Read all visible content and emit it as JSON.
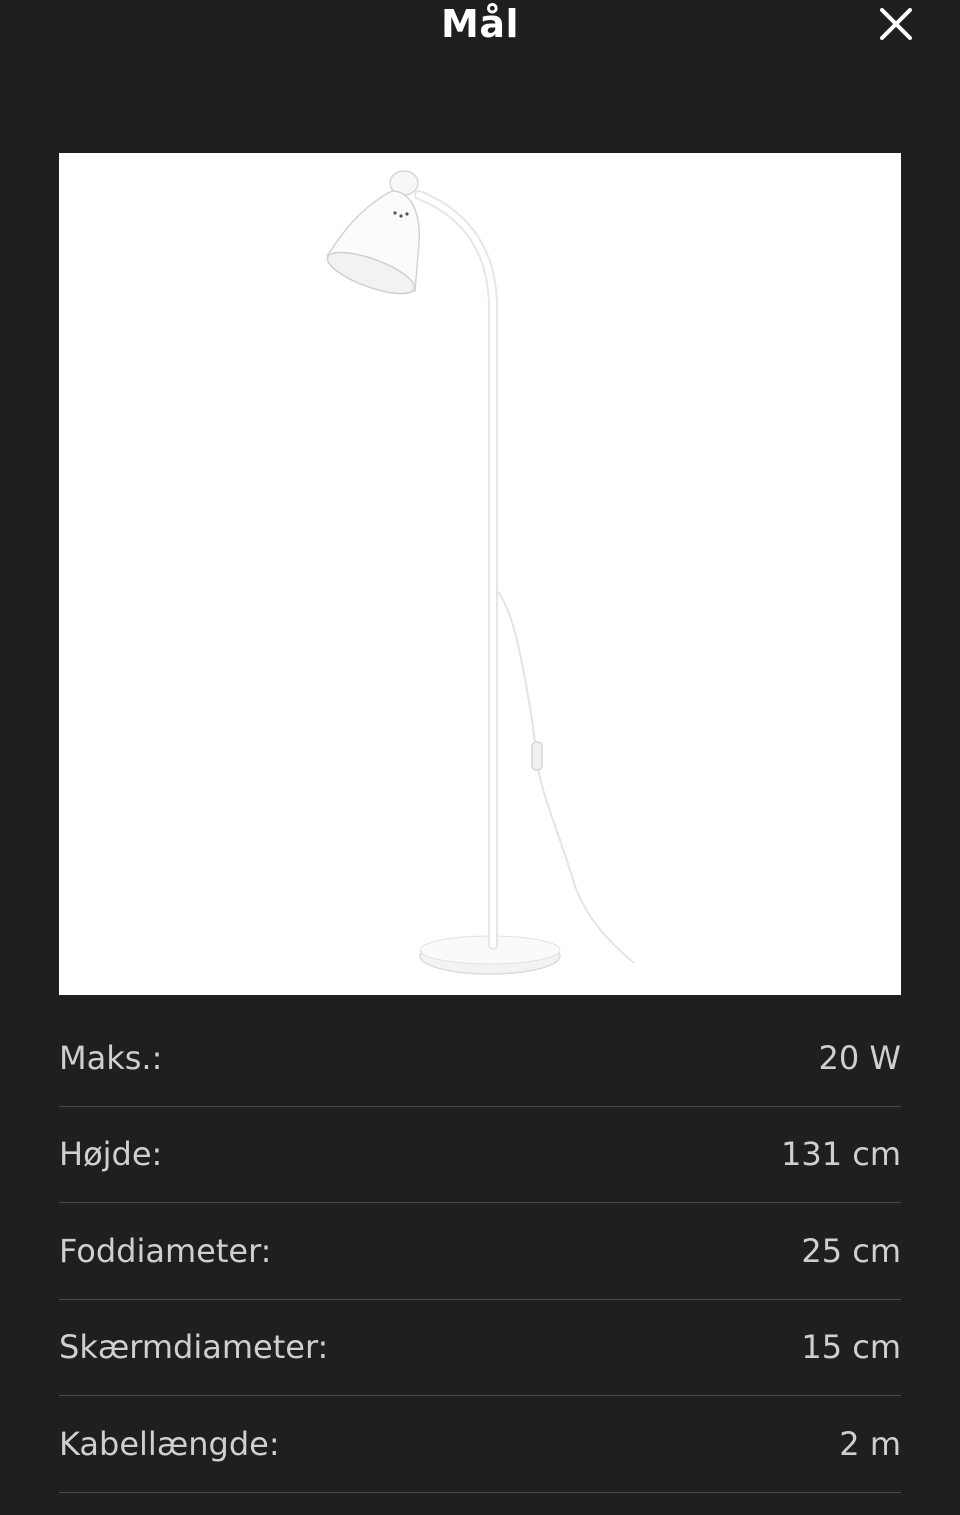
{
  "header": {
    "title": "Mål",
    "close_icon": "close-icon"
  },
  "product_image": {
    "icon": "floor-lamp-image",
    "background": "#ffffff"
  },
  "specs": [
    {
      "label": "Maks.:",
      "value": "20 W"
    },
    {
      "label": "Højde:",
      "value": "131 cm"
    },
    {
      "label": "Foddiameter:",
      "value": "25 cm"
    },
    {
      "label": "Skærmdiameter:",
      "value": "15 cm"
    },
    {
      "label": "Kabellængde:",
      "value": "2 m"
    }
  ],
  "colors": {
    "background": "#1f1f21",
    "text": "#ffffff",
    "spec_text": "#cfcfd1",
    "divider": "#4a4a4d"
  }
}
